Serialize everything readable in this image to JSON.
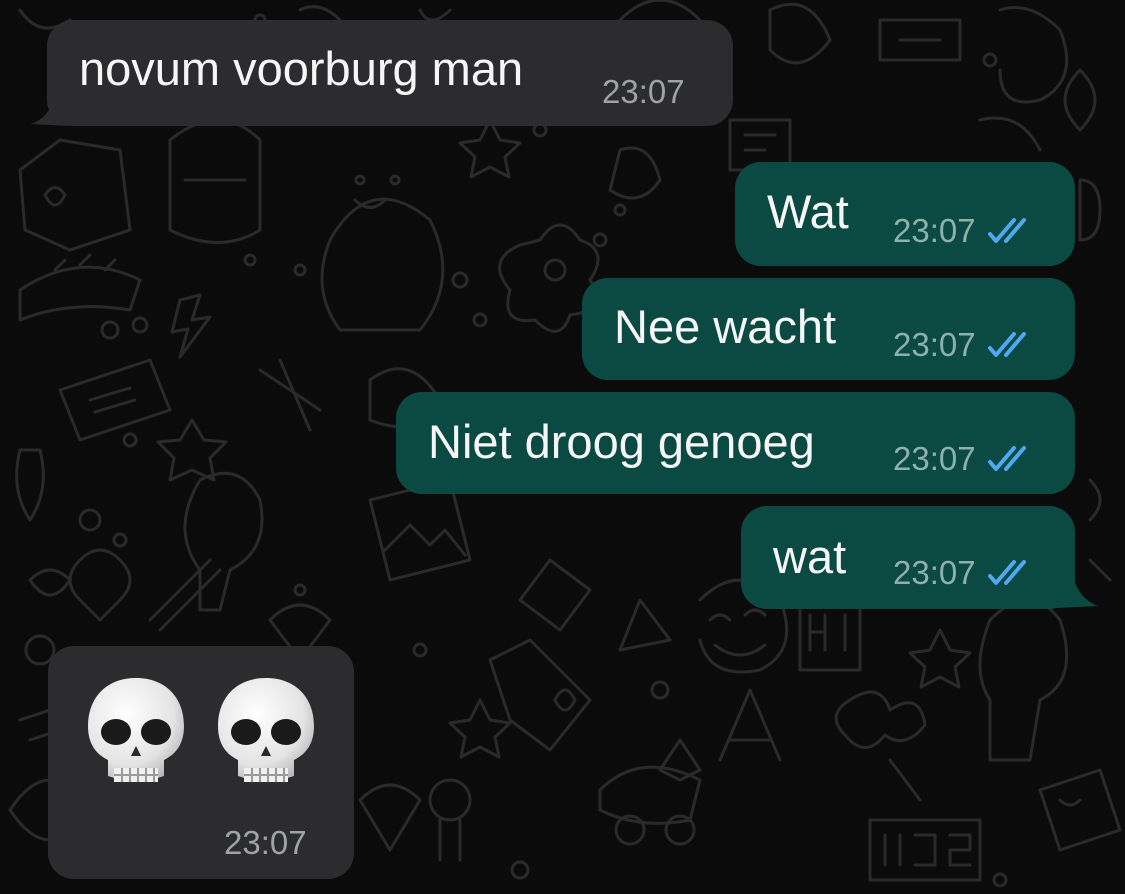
{
  "chat": {
    "messages": [
      {
        "direction": "incoming",
        "text": "novum voorburg man",
        "time": "23:07"
      },
      {
        "direction": "outgoing",
        "text": "Wat",
        "time": "23:07",
        "status": "read"
      },
      {
        "direction": "outgoing",
        "text": "Nee wacht",
        "time": "23:07",
        "status": "read"
      },
      {
        "direction": "outgoing",
        "text": "Niet droog genoeg",
        "time": "23:07",
        "status": "read"
      },
      {
        "direction": "outgoing",
        "text": "wat",
        "time": "23:07",
        "status": "read"
      },
      {
        "direction": "incoming",
        "emoji": [
          "skull-emoji",
          "skull-emoji"
        ],
        "time": "23:07"
      }
    ]
  },
  "colors": {
    "background": "#0b0b0b",
    "incoming_bubble": "#2c2c2e",
    "outgoing_bubble": "#0a4a42",
    "read_ticks": "#4fa9f2",
    "timestamp": "#9ea3a7"
  }
}
